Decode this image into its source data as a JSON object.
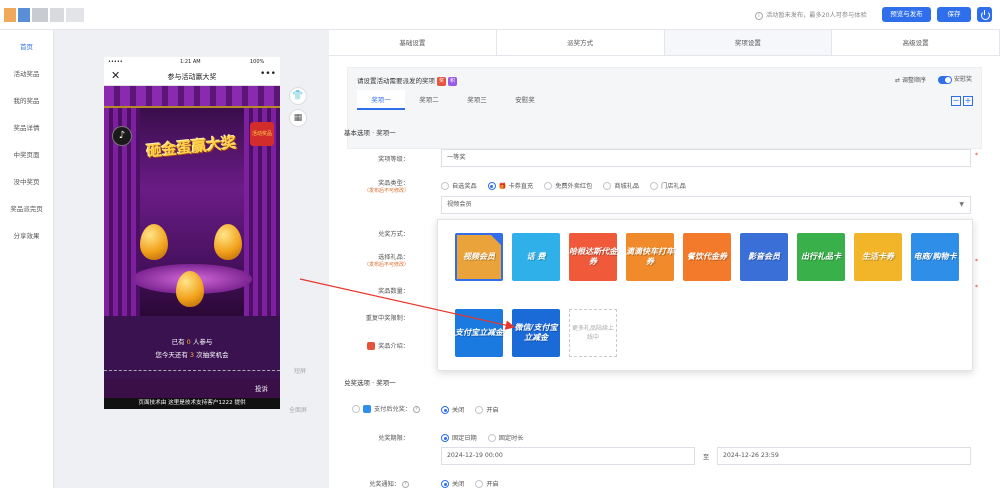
{
  "topbar": {
    "note": "活动暂未发布，最多20人可参与体验",
    "preview_publish": "预览与发布",
    "save": "保存"
  },
  "sidebar": {
    "items": [
      {
        "label": "首页"
      },
      {
        "label": "活动奖品"
      },
      {
        "label": "我的奖品"
      },
      {
        "label": "奖品详情"
      },
      {
        "label": "中奖页面"
      },
      {
        "label": "没中奖页"
      },
      {
        "label": "奖品派完页"
      },
      {
        "label": "分享效果"
      }
    ]
  },
  "phone": {
    "status_left": "•••••",
    "status_time": "1:21 AM",
    "status_right": "100%",
    "nav_title": "参与活动赢大奖",
    "title_art": "砸金蛋赢大奖",
    "badge": "活动奖品",
    "line1_pre": "已有",
    "line1_num": "0",
    "line1_post": "人参与",
    "line2_pre": "您今天还有",
    "line2_num": "3",
    "line2_post": "次抽奖机会",
    "complain": "投诉",
    "footer": "页面技术由 这里是技术支持客户1222 提供"
  },
  "preview_marks": {
    "short": "短屏",
    "full": "全面屏"
  },
  "steps": [
    "基础设置",
    "派奖方式",
    "奖项设置",
    "高级设置"
  ],
  "panel": {
    "title": "请设置活动需要派发的奖项",
    "sort": "调整顺序",
    "toggle_label": "安慰奖",
    "tabs": [
      "奖项一",
      "奖项二",
      "奖项三",
      "安慰奖"
    ]
  },
  "basic": {
    "section": "基本选项 · 奖项一",
    "level_label": "奖项等级：",
    "level_value": "一等奖",
    "type_label": "奖品类型：",
    "type_hint": "（发布后不可修改）",
    "types": [
      "自选奖品",
      "卡券直充",
      "免费外卖红包",
      "商城礼品",
      "门店礼品"
    ],
    "select_value": "视频会员",
    "redeem_label": "兑奖方式：",
    "gift_label": "选择礼品：",
    "gift_hint": "（发布后不可修改）",
    "qty_label": "奖品数量：",
    "repeat_label": "重复中奖限制：",
    "intro_label": "奖品介绍："
  },
  "cards": [
    {
      "text": "视频会员",
      "color": "#e9a33a",
      "selected": true
    },
    {
      "text": "话 费",
      "color": "#2fb0e8"
    },
    {
      "text": "哈根达斯代金券",
      "color": "#f05a3a"
    },
    {
      "text": "滴滴快车打车券",
      "color": "#f08a2a"
    },
    {
      "text": "餐饮代金券",
      "color": "#f27a2a"
    },
    {
      "text": "影音会员",
      "color": "#3a6fd8"
    },
    {
      "text": "出行礼品卡",
      "color": "#3ab04a"
    },
    {
      "text": "生活卡券",
      "color": "#f2b52a"
    },
    {
      "text": "电商/购物卡",
      "color": "#2f8fe8"
    },
    {
      "text": "支付宝立减金",
      "color": "#1a7ae0"
    },
    {
      "text": "微信/支付宝立减金",
      "color": "#1a6ad8"
    }
  ],
  "more_card": "更多礼品陆续上线中",
  "redeem": {
    "section": "兑奖选项 · 奖项一",
    "pay_label": "支付后兑奖：",
    "off": "关闭",
    "on": "开启",
    "period_label": "兑奖期限：",
    "fixed_date": "固定日期",
    "fixed_time": "固定时长",
    "start": "2024-12-19 00:00",
    "to": "至",
    "end": "2024-12-26 23:59",
    "notice_label": "兑奖通知："
  }
}
